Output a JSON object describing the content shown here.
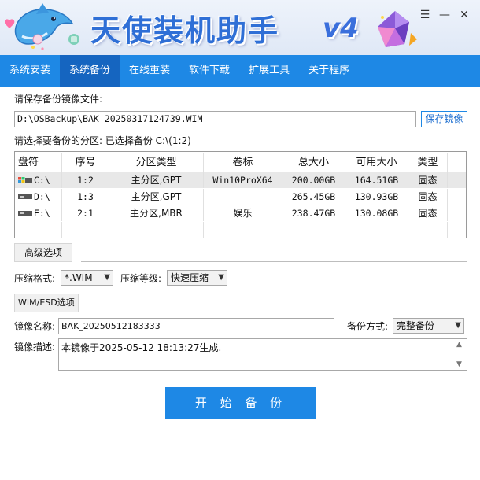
{
  "app": {
    "title": "天使装机助手",
    "version": "v4",
    "window_controls": {
      "menu": "☰",
      "minimize": "—",
      "close": "✕"
    }
  },
  "nav": {
    "items": [
      {
        "label": "系统安装"
      },
      {
        "label": "系统备份"
      },
      {
        "label": "在线重装"
      },
      {
        "label": "软件下载"
      },
      {
        "label": "扩展工具"
      },
      {
        "label": "关于程序"
      }
    ],
    "active_index": 1
  },
  "save": {
    "label": "请保存备份镜像文件:",
    "path": "D:\\OSBackup\\BAK_20250317124739.WIM",
    "button": "保存镜像"
  },
  "partition": {
    "label": "请选择要备份的分区: 已选择备份 C:\\(1:2)",
    "columns": [
      "盘符",
      "序号",
      "分区类型",
      "卷标",
      "总大小",
      "可用大小",
      "类型"
    ],
    "rows": [
      {
        "drive": "C:\\",
        "index": "1:2",
        "ptype": "主分区,GPT",
        "volume": "Win10ProX64",
        "total": "200.00GB",
        "free": "164.51GB",
        "kind": "固态",
        "is_system": true
      },
      {
        "drive": "D:\\",
        "index": "1:3",
        "ptype": "主分区,GPT",
        "volume": "",
        "total": "265.45GB",
        "free": "130.93GB",
        "kind": "固态",
        "is_system": false
      },
      {
        "drive": "E:\\",
        "index": "2:1",
        "ptype": "主分区,MBR",
        "volume": "娱乐",
        "total": "238.47GB",
        "free": "130.08GB",
        "kind": "固态",
        "is_system": false
      }
    ]
  },
  "advanced": {
    "tab": "高级选项",
    "format_label": "压缩格式:",
    "format_value": "*.WIM",
    "level_label": "压缩等级:",
    "level_value": "快速压缩"
  },
  "wim": {
    "tab": "WIM/ESD选项",
    "name_label": "镜像名称:",
    "name_value": "BAK_20250512183333",
    "mode_label": "备份方式:",
    "mode_value": "完整备份",
    "desc_label": "镜像描述:",
    "desc_value": "本镜像于2025-05-12 18:13:27生成."
  },
  "start_button": "开 始 备 份",
  "colors": {
    "accent": "#1e88e5",
    "accent_dark": "#1565c0",
    "title": "#2f6fd6"
  }
}
